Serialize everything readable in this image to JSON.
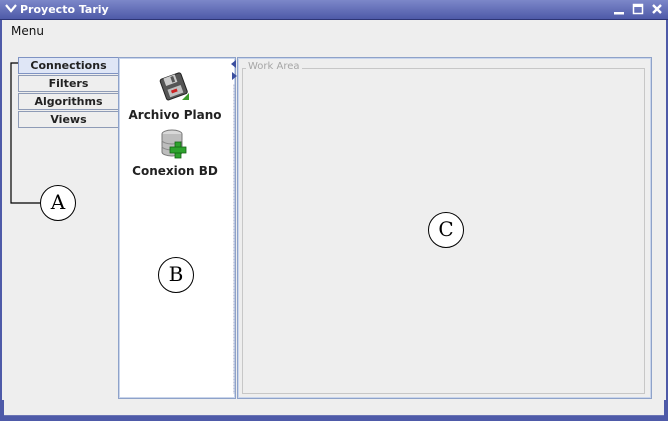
{
  "window": {
    "title": "Proyecto Tariy",
    "menu_glyph": "❯",
    "minimize_glyph": "▁",
    "maximize_glyph": "❐",
    "close_glyph": "✕"
  },
  "menubar": {
    "items": [
      {
        "label": "Menu"
      }
    ]
  },
  "tabs": [
    {
      "label": "Connections",
      "active": true
    },
    {
      "label": "Filters",
      "active": false
    },
    {
      "label": "Algorithms",
      "active": false
    },
    {
      "label": "Views",
      "active": false
    }
  ],
  "tools": [
    {
      "label": "Archivo Plano",
      "icon": "floppy-disk-icon"
    },
    {
      "label": "Conexion BD",
      "icon": "database-add-icon"
    }
  ],
  "work_area": {
    "title": "Work Area"
  },
  "annotations": [
    "A",
    "B",
    "C"
  ],
  "colors": {
    "titlebar": "#4e5aa8",
    "panel_border": "#8ea2c9",
    "active_tab": "#dfe6f6"
  }
}
